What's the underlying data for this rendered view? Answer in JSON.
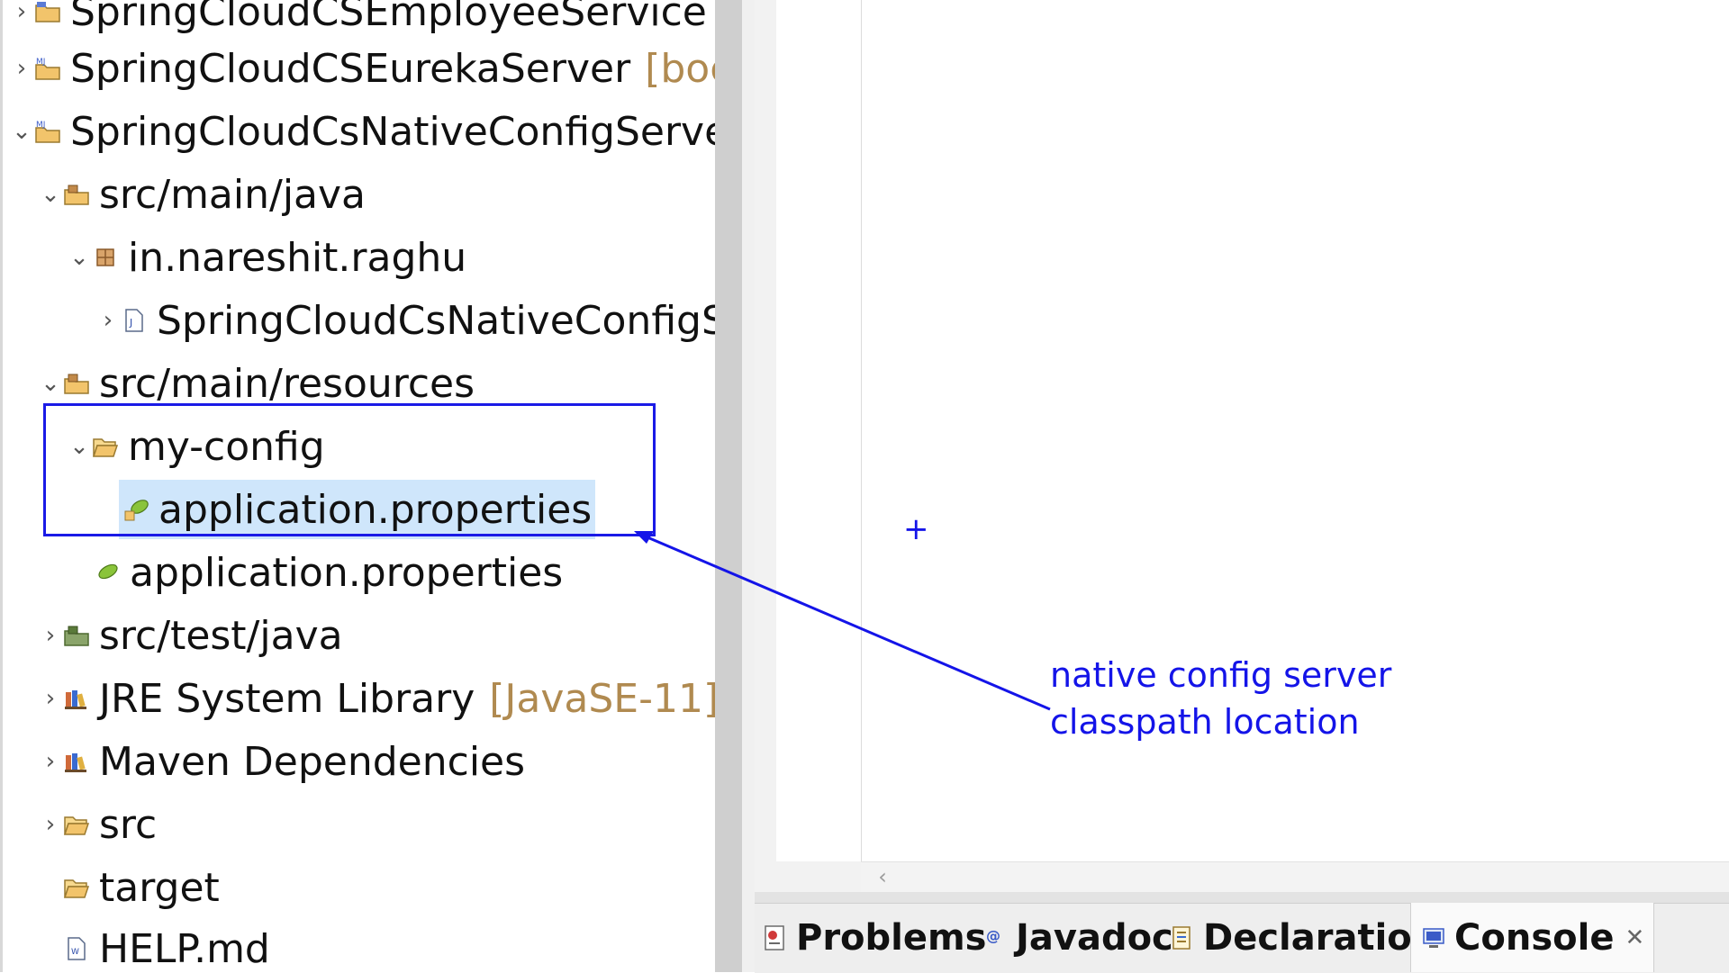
{
  "explorer": {
    "items": [
      {
        "label": "SpringCloudCSEmployeeService",
        "decoration": "[",
        "chevron": "›"
      },
      {
        "label": "SpringCloudCSEurekaServer",
        "decoration": "[boc",
        "chevron": "›"
      },
      {
        "label": "SpringCloudCsNativeConfigServe",
        "decoration": "",
        "chevron": "⌄"
      },
      {
        "label": "src/main/java",
        "chevron": "⌄"
      },
      {
        "label": "in.nareshit.raghu",
        "chevron": "⌄"
      },
      {
        "label": "SpringCloudCsNativeConfigS",
        "chevron": "›"
      },
      {
        "label": "src/main/resources",
        "chevron": "⌄"
      },
      {
        "label": "my-config",
        "chevron": "⌄"
      },
      {
        "label": "application.properties",
        "chevron": ""
      },
      {
        "label": "application.properties",
        "chevron": ""
      },
      {
        "label": "src/test/java",
        "chevron": "›"
      },
      {
        "label": "JRE System Library",
        "decoration": "[JavaSE-11]",
        "chevron": "›"
      },
      {
        "label": "Maven Dependencies",
        "chevron": "›"
      },
      {
        "label": "src",
        "chevron": "›"
      },
      {
        "label": "target",
        "chevron": ""
      },
      {
        "label": "HELP.md",
        "chevron": ""
      }
    ]
  },
  "annotation": {
    "line1": "native config server",
    "line2": "classpath location",
    "cursor": "+"
  },
  "bottom_tabs": {
    "problems": "Problems",
    "javadoc": "Javadoc",
    "declaration": "Declaration",
    "console": "Console",
    "close": "✕"
  },
  "scroll": {
    "left_arrow": "‹"
  },
  "colors": {
    "annotation_blue": "#1414e8",
    "selection": "#cfe6fb",
    "decoration": "#b08a50"
  }
}
